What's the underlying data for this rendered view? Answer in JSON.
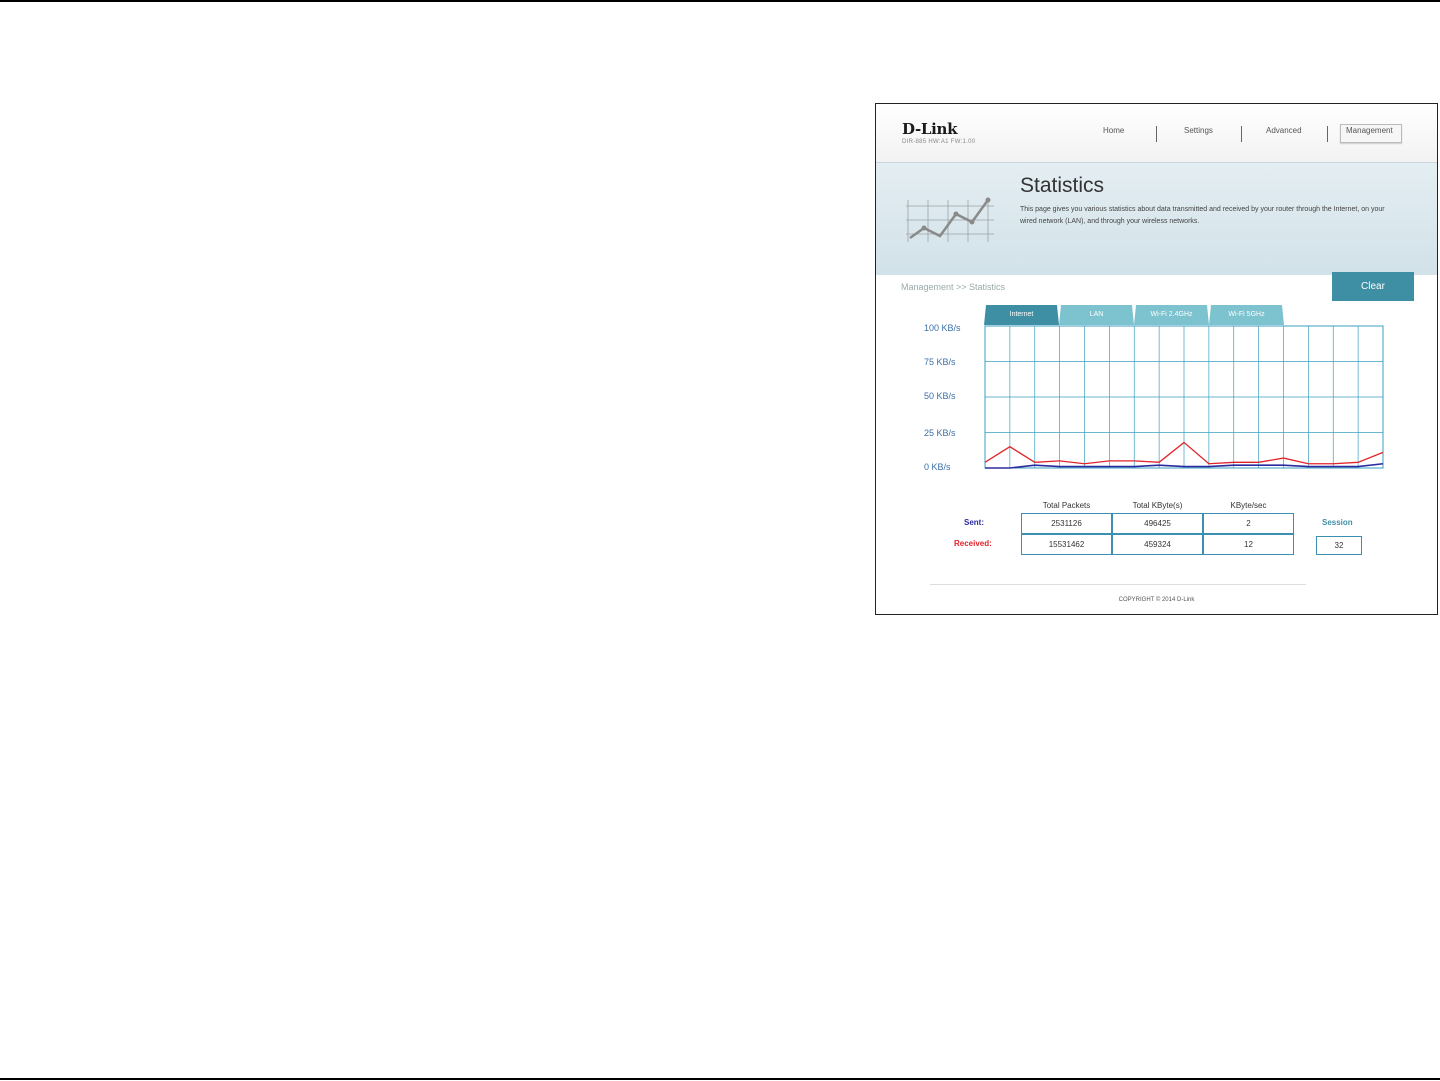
{
  "header": {
    "brand": "D-Link",
    "model": "DIR-885   HW:A1   FW:1.00",
    "nav": [
      "Home",
      "Settings",
      "Advanced",
      "Management"
    ]
  },
  "banner": {
    "title": "Statistics",
    "description": "This page gives you various statistics about data transmitted and received by your router through the Internet, on your wired network (LAN), and through your wireless networks."
  },
  "breadcrumb": "Management >> Statistics",
  "clear_label": "Clear",
  "tabs": [
    "Internet",
    "LAN",
    "Wi-Fi 2.4GHz",
    "Wi-Fi 5GHz"
  ],
  "active_tab": "Internet",
  "y_axis_labels": [
    "100 KB/s",
    "75 KB/s",
    "50 KB/s",
    "25 KB/s",
    "0 KB/s"
  ],
  "chart_data": {
    "type": "line",
    "y_unit": "KB/s",
    "ylim": [
      0,
      100
    ],
    "grid": true,
    "x": [
      0,
      1,
      2,
      3,
      4,
      5,
      6,
      7,
      8,
      9,
      10,
      11,
      12,
      13,
      14,
      15,
      16
    ],
    "series": [
      {
        "color": "#e0242b",
        "values": [
          4,
          15,
          4,
          5,
          3,
          5,
          5,
          4,
          18,
          3,
          4,
          4,
          7,
          3,
          3,
          4,
          11
        ]
      },
      {
        "color": "#2b2b9f",
        "values": [
          0,
          0,
          2,
          1,
          1,
          1,
          1,
          2,
          1,
          1,
          2,
          2,
          2,
          1,
          1,
          1,
          3
        ]
      }
    ]
  },
  "table": {
    "headers": [
      "Total Packets",
      "Total KByte(s)",
      "KByte/sec"
    ],
    "rows": [
      {
        "label": "Sent:",
        "values": [
          "2531126",
          "496425",
          "2"
        ]
      },
      {
        "label": "Received:",
        "values": [
          "15531462",
          "459324",
          "12"
        ]
      }
    ],
    "session_label": "Session",
    "session_value": "32"
  },
  "copyright": "COPYRIGHT © 2014 D-Link",
  "colors": {
    "accent": "#3e8fa3",
    "sent": "#2b2b9f",
    "received": "#e0242b",
    "grid": "#3b9fc0"
  }
}
